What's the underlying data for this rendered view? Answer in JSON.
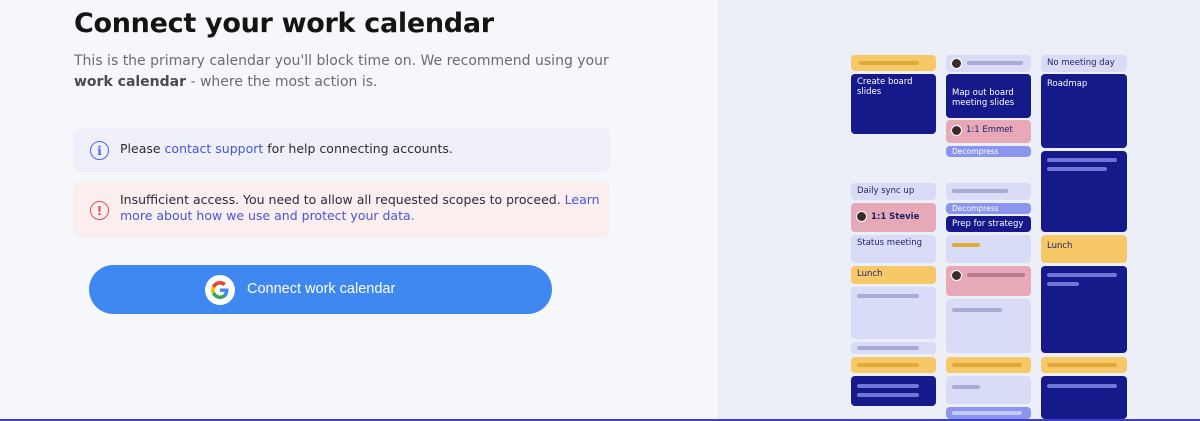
{
  "header": {
    "title": "Connect your work calendar",
    "subtitle_part1": "This is the primary calendar you'll block time on. We recommend using your ",
    "subtitle_bold": "work calendar",
    "subtitle_part2": " - where the most action is."
  },
  "info": {
    "prefix": "Please ",
    "link": "contact support",
    "suffix": " for help connecting accounts."
  },
  "error": {
    "text": "Insufficient access. You need to allow all requested scopes to proceed. ",
    "link": "Learn more about how we use and protect your data."
  },
  "cta": {
    "label": "Connect work calendar",
    "icon": "google-icon"
  },
  "calendar": {
    "create_board_slides": "Create board slides",
    "map_out_board_meeting_slides": "Map out board meeting slides",
    "emmet": "1:1 Emmet",
    "decompress_1": "Decompress",
    "no_meeting_day": "No meeting day",
    "roadmap": "Roadmap",
    "daily_sync_up": "Daily sync up",
    "stevie": "1:1 Stevie",
    "decompress_2": "Decompress",
    "prep_for_strategy": "Prep for strategy",
    "status_meeting": "Status meeting",
    "lunch_1": "Lunch",
    "lunch_2": "Lunch"
  },
  "colors": {
    "accent": "#3f88f1",
    "link": "#4558d8",
    "info_bg": "#eeeff9",
    "error_bg": "#faeeee",
    "error": "#e0504a",
    "event_yellow": "#f7c868",
    "event_lavender": "#d9dcf6",
    "event_dark": "#15198a",
    "event_pink": "#e7a8b8",
    "event_blue": "#8c95ee"
  }
}
